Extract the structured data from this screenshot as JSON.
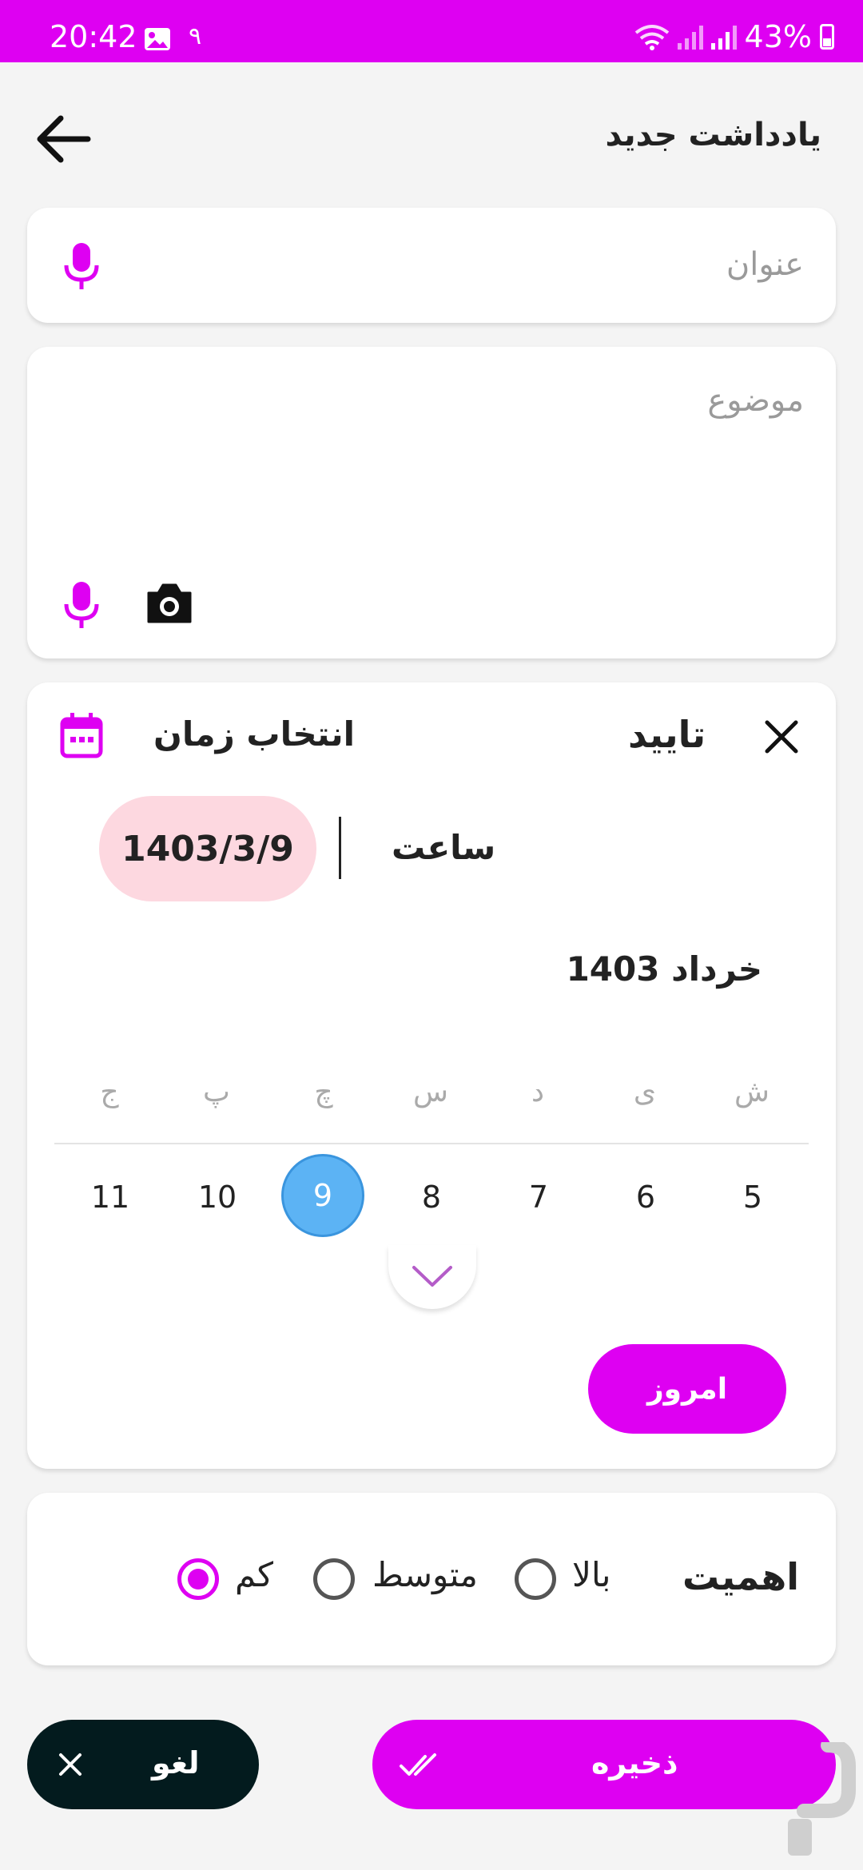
{
  "status_bar": {
    "time": "20:42",
    "notification_count": "۹",
    "battery": "43%"
  },
  "header": {
    "title": "یادداشت جدید"
  },
  "title_field": {
    "placeholder": "عنوان"
  },
  "subject_field": {
    "placeholder": "موضوع"
  },
  "calendar": {
    "header_label": "انتخاب زمان",
    "confirm_label": "تایید",
    "selected_date": "1403/3/9",
    "hour_label": "ساعت",
    "month_label": "خرداد 1403",
    "weekdays": [
      "ش",
      "ی",
      "د",
      "س",
      "چ",
      "پ",
      "ج"
    ],
    "days": [
      "5",
      "6",
      "7",
      "8",
      "9",
      "10",
      "11"
    ],
    "selected_day": "9",
    "today_label": "امروز"
  },
  "priority": {
    "label": "اهمیت",
    "options": [
      "بالا",
      "متوسط",
      "کم"
    ],
    "selected": "کم"
  },
  "actions": {
    "save_label": "ذخیره",
    "cancel_label": "لغو"
  },
  "colors": {
    "accent": "#de00f2",
    "dark": "#031b1e",
    "chip": "#fdd8e0",
    "selected_day": "#5cb3f4"
  }
}
